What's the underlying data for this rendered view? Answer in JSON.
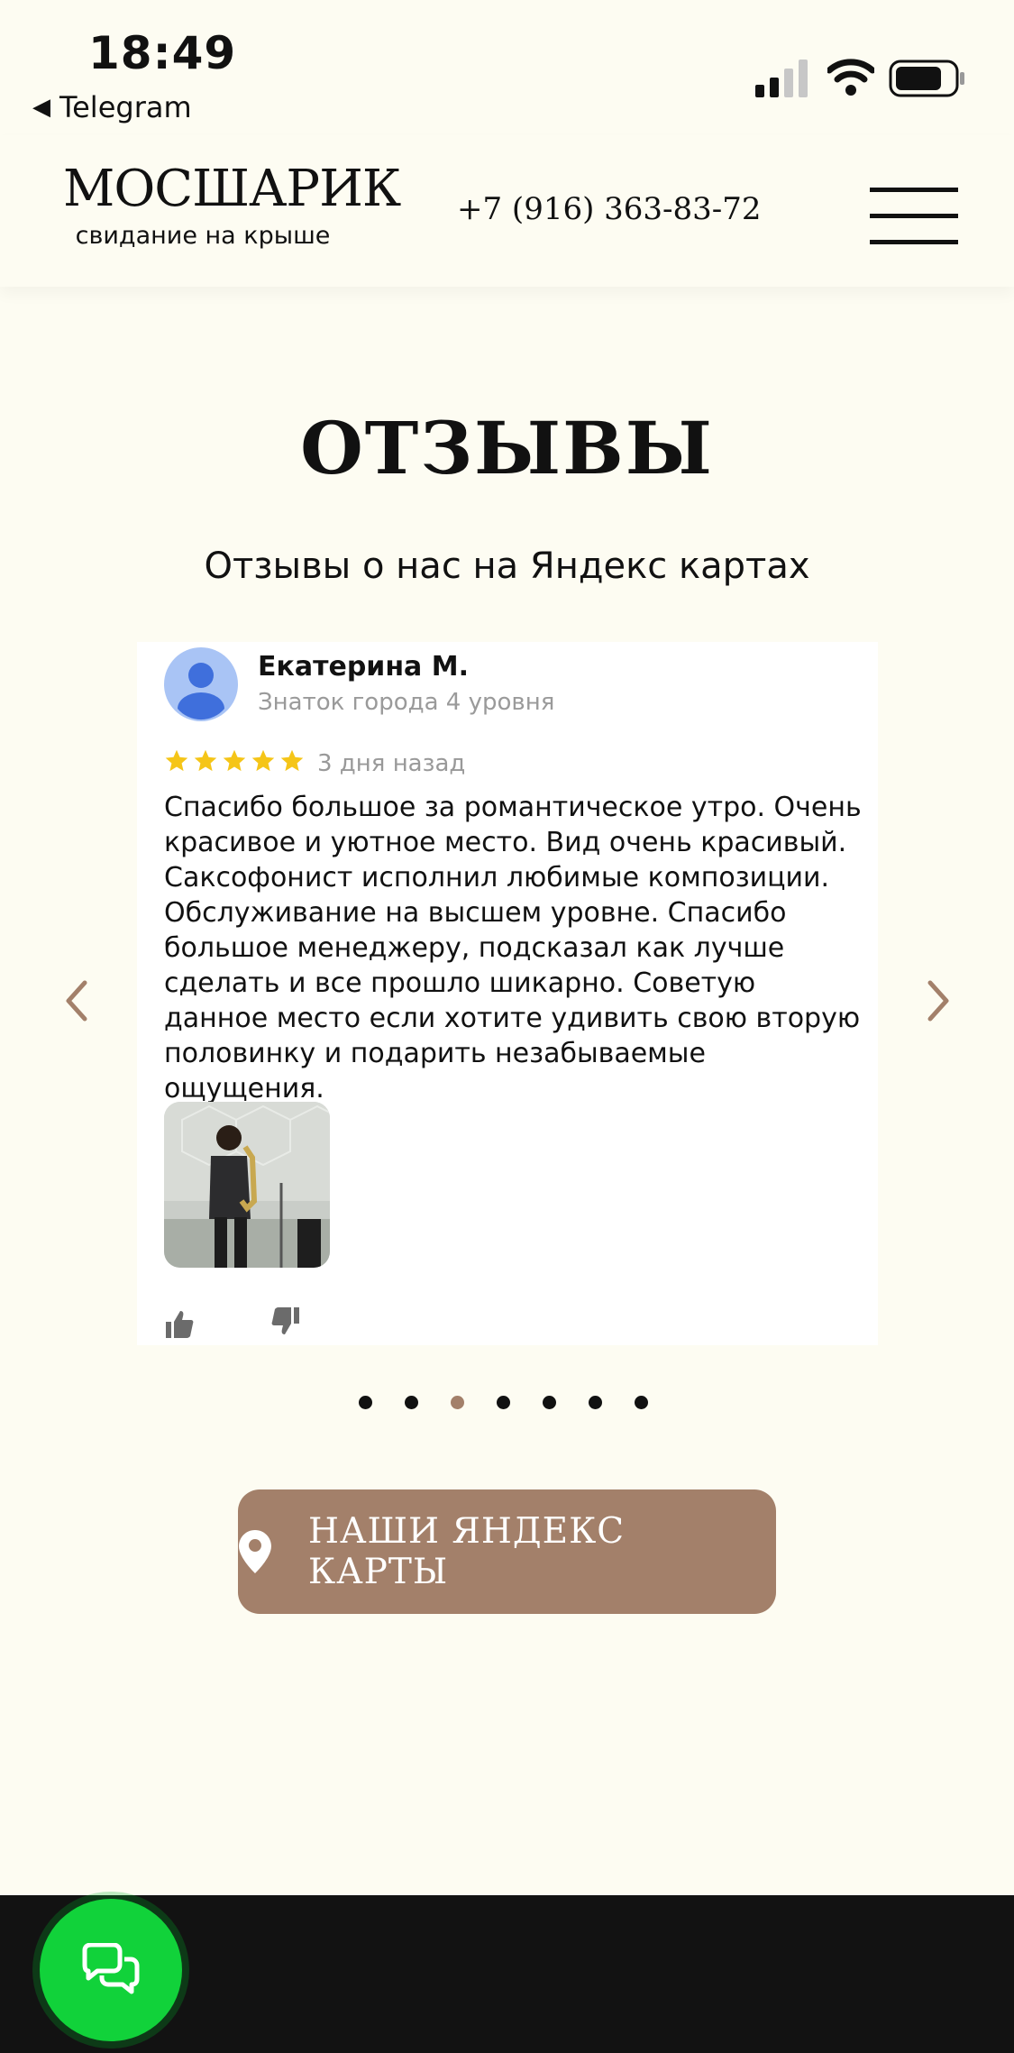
{
  "status_bar": {
    "time": "18:49",
    "back_app": "Telegram",
    "back_icon": "back-triangle-icon"
  },
  "header": {
    "logo_name": "МОСШАРИК",
    "logo_tagline": "свидание на крыше",
    "phone": "+7 (916) 363-83-72"
  },
  "main": {
    "title": "ОТЗЫВЫ",
    "subtitle": "Отзывы о нас на Яндекс картах"
  },
  "review": {
    "author": "Екатерина М.",
    "level": "Знаток города 4 уровня",
    "rating": 5,
    "date": "3 дня назад",
    "text": "Спасибо большое за романтическое утро. Очень красивое и уютное место. Вид очень красивый. Саксофонист исполнил любимые композиции. Обслуживание на высшем уровне. Спасибо большое менеджеру, подсказал как лучше сделать и все прошло шикарно. Советую данное место если хотите удивить свою вторую половинку и подарить незабываемые ощущения."
  },
  "carousel": {
    "total": 7,
    "active_index": 2
  },
  "maps_button": {
    "label": "НАШИ ЯНДЕКС КАРТЫ",
    "icon": "map-pin-icon"
  },
  "colors": {
    "background": "#fdfcf2",
    "accent": "#a3806a",
    "chat_green": "#11d23a",
    "star": "#f5c518"
  }
}
